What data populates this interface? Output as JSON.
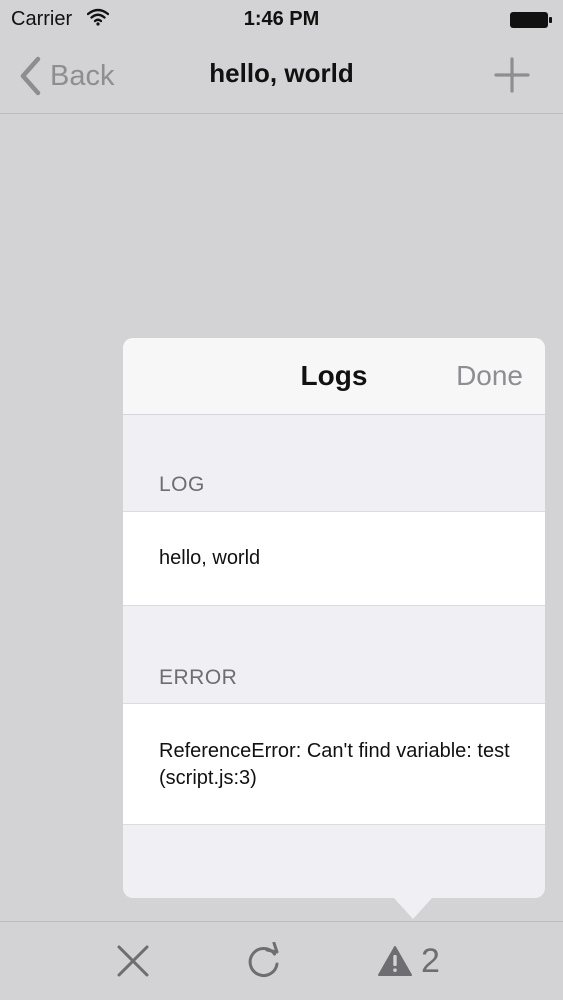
{
  "status_bar": {
    "carrier": "Carrier",
    "time": "1:46 PM",
    "wifi_icon": "wifi-icon",
    "battery_icon": "battery-icon"
  },
  "nav": {
    "back_label": "Back",
    "back_icon": "chevron-left-icon",
    "title": "hello, world",
    "add_icon": "plus-icon"
  },
  "logs_popover": {
    "title": "Logs",
    "done_label": "Done",
    "sections": [
      {
        "header": "LOG",
        "entries": [
          "hello, world"
        ]
      },
      {
        "header": "ERROR",
        "entries": [
          "ReferenceError: Can't find variable: test (script.js:3)"
        ]
      }
    ]
  },
  "toolbar": {
    "close_icon": "close-icon",
    "reload_icon": "reload-icon",
    "warning_icon": "warning-icon",
    "warning_count": "2"
  },
  "colors": {
    "background": "#d3d2d5",
    "popover_background": "#efeff4",
    "muted_text": "#8e8e92",
    "section_header_text": "#6d6d72"
  }
}
